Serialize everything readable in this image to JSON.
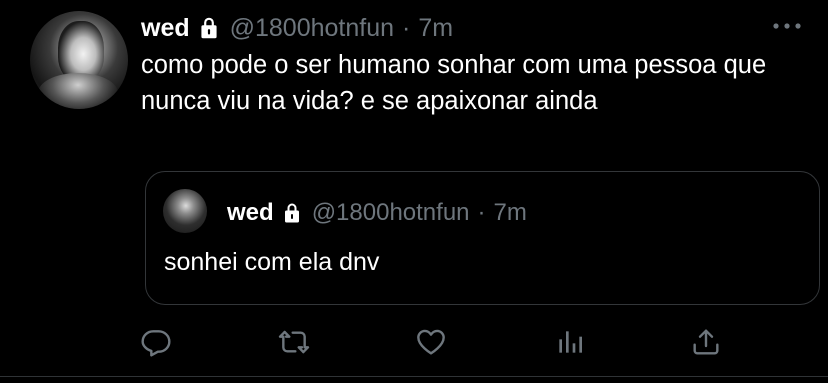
{
  "tweet": {
    "author": {
      "name": "wed",
      "handle": "@1800hotnfun",
      "separator": "·",
      "time": "7m",
      "protected_icon": "lock-icon"
    },
    "text": "como pode o ser humano sonhar com uma pessoa que nunca viu na vida? e se apaixonar ainda",
    "more_icon": "more-icon",
    "quote": {
      "name": "wed",
      "handle": "@1800hotnfun",
      "separator": "·",
      "time": "7m",
      "text": "sonhei com ela dnv"
    },
    "actions": [
      {
        "icon": "reply-icon"
      },
      {
        "icon": "retweet-icon"
      },
      {
        "icon": "like-icon"
      },
      {
        "icon": "analytics-icon"
      },
      {
        "icon": "share-icon"
      }
    ]
  },
  "colors": {
    "background": "#000000",
    "text": "#ffffff",
    "muted": "#6e767d",
    "border": "#333639"
  }
}
